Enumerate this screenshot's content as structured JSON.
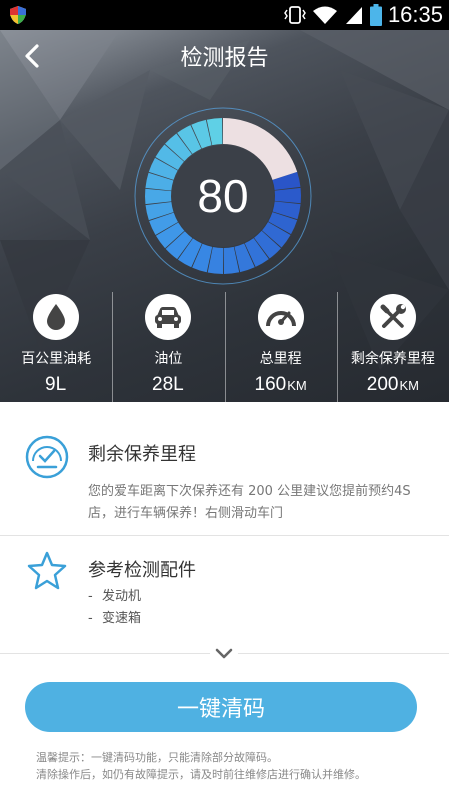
{
  "status_bar": {
    "time": "16:35"
  },
  "header": {
    "title": "检测报告",
    "score": "80"
  },
  "gauge": {
    "score_fraction": 0.8,
    "colors": {
      "light": "#5fd0e6",
      "mid": "#3a8ee8",
      "dark": "#2a55c8",
      "remaining": "#ede0e2"
    }
  },
  "stats": [
    {
      "label": "百公里油耗",
      "value": "9L",
      "unit": "",
      "icon": "water-drop-icon"
    },
    {
      "label": "油位",
      "value": "28L",
      "unit": "",
      "icon": "car-icon"
    },
    {
      "label": "总里程",
      "value": "160",
      "unit": "KM",
      "icon": "speedometer-icon"
    },
    {
      "label": "剩余保养里程",
      "value": "200",
      "unit": "KM",
      "icon": "wrench-screwdriver-icon"
    }
  ],
  "maintenance": {
    "title": "剩余保养里程",
    "desc": "您的爱车距离下次保养还有 200 公里建议您提前预约4S店，进行车辆保养！右侧滑动车门",
    "icon": "dashboard-gauge-icon"
  },
  "parts": {
    "title": "参考检测配件",
    "items": [
      "发动机",
      "变速箱"
    ],
    "icon": "star-icon"
  },
  "actions": {
    "clear_label": "一键清码"
  },
  "tips": {
    "line1": "温馨提示：一键清码功能，只能清除部分故障码。",
    "line2": "清除操作后，如仍有故障提示，请及时前往维修店进行确认并维修。"
  },
  "colors": {
    "accent": "#4fb1e2",
    "icon_blue": "#3aa0d8",
    "header_bg": "#3a3f47"
  }
}
